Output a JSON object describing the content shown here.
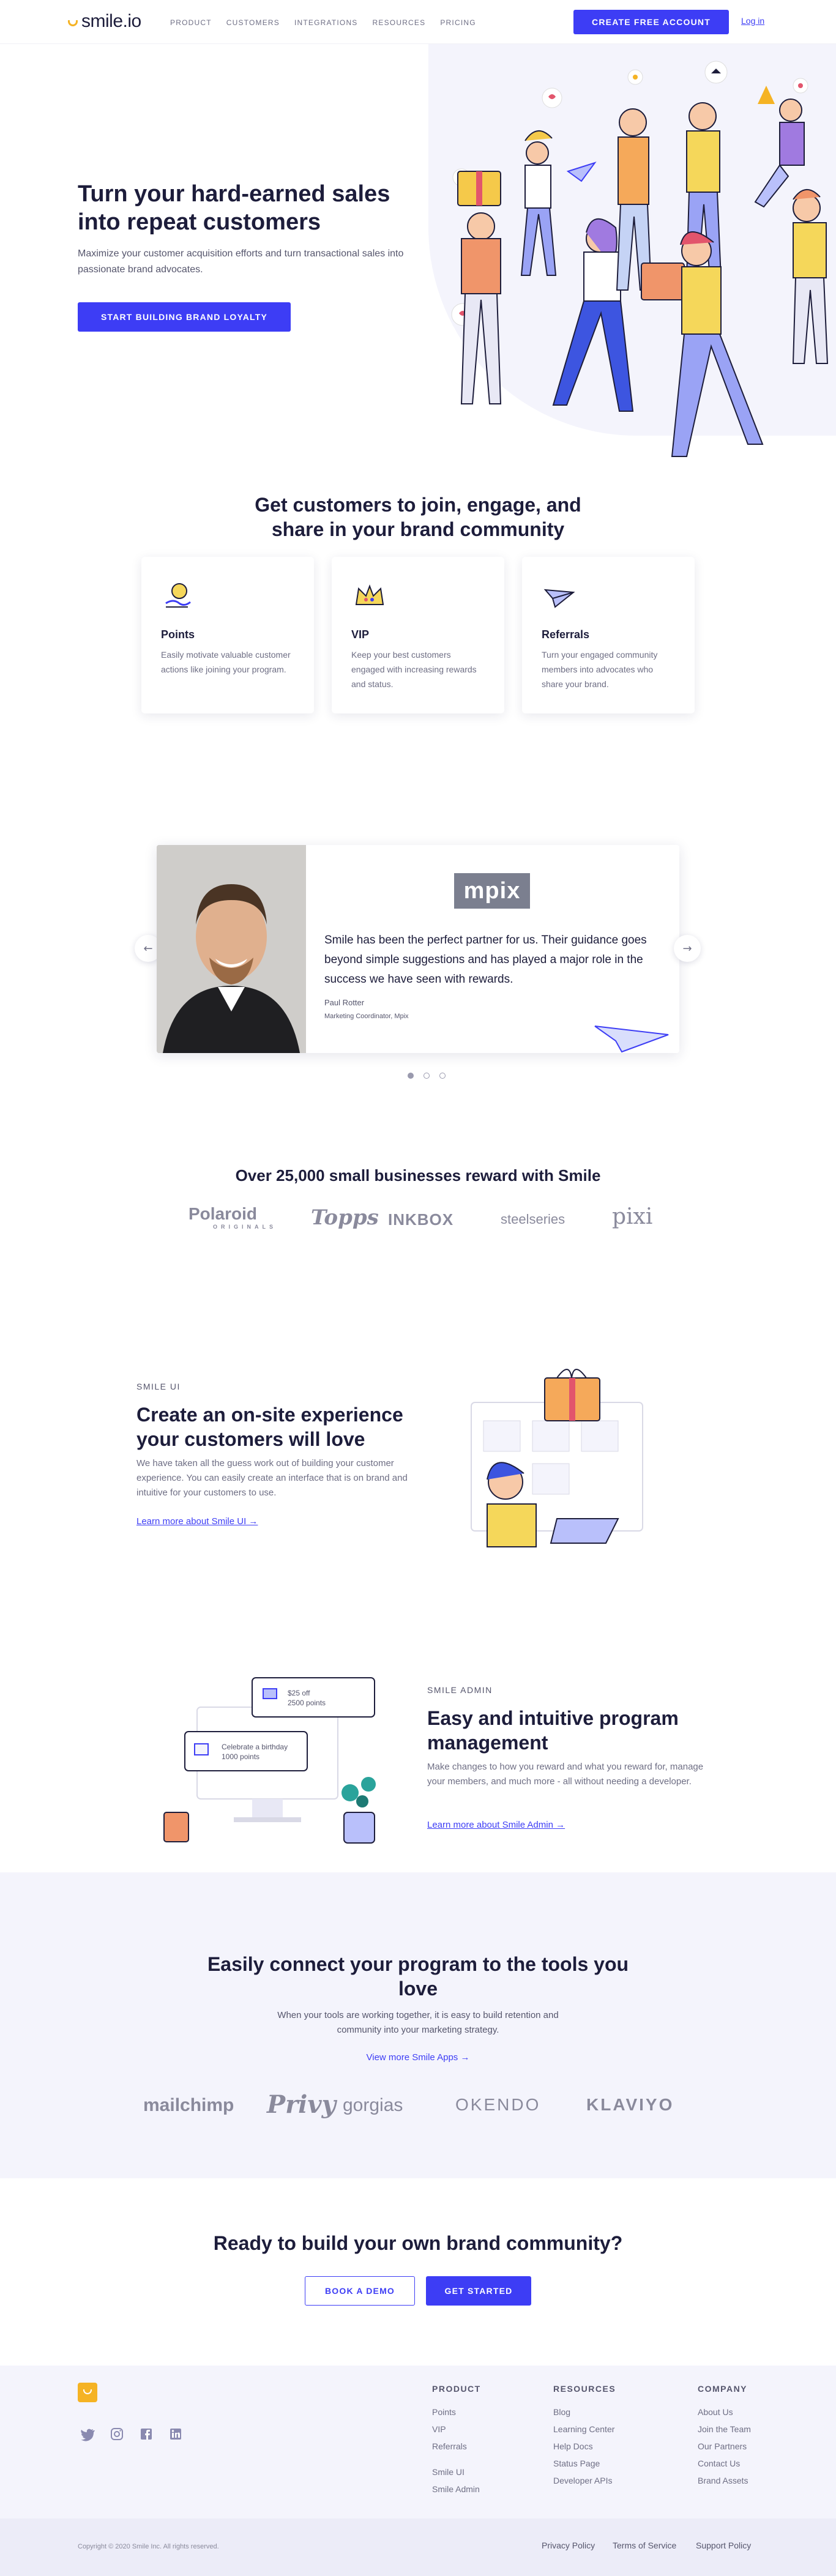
{
  "brand": {
    "name": "smile.io"
  },
  "nav": {
    "links": [
      "PRODUCT",
      "CUSTOMERS",
      "INTEGRATIONS",
      "RESOURCES",
      "PRICING"
    ],
    "cta_label": "CREATE FREE ACCOUNT",
    "login_label": "Log in"
  },
  "hero": {
    "title": "Turn your hard-earned sales into repeat customers",
    "subtitle": "Maximize your customer acquisition efforts and turn transactional sales into passionate brand advocates.",
    "cta_label": "START BUILDING BRAND LOYALTY"
  },
  "features": {
    "title": "Get customers to join, engage, and share in your brand community",
    "cards": [
      {
        "icon": "points-hand-icon",
        "title": "Points",
        "desc": "Easily motivate valuable customer actions like joining your program."
      },
      {
        "icon": "crown-icon",
        "title": "VIP",
        "desc": "Keep your best customers engaged with increasing rewards and status."
      },
      {
        "icon": "paper-plane-icon",
        "title": "Referrals",
        "desc": "Turn your engaged community members into advocates who share your brand."
      }
    ]
  },
  "testimonial": {
    "logo": "mpix",
    "quote": "Smile has been the perfect partner for us. Their guidance goes beyond simple suggestions and has played a major role in the success we have seen with rewards.",
    "name": "Paul Rotter",
    "role": "Marketing Coordinator, Mpix",
    "prev_icon": "arrow-left-icon",
    "next_icon": "arrow-right-icon",
    "slides": 3,
    "active_slide": 1
  },
  "brands": {
    "title": "Over 25,000 small businesses reward with Smile",
    "logos": [
      "Polaroid",
      "ORIGINALS",
      "Topps",
      "INKBOX",
      "steelseries",
      "pixi"
    ]
  },
  "smile_ui": {
    "eyebrow": "SMILE UI",
    "title": "Create an on-site experience your customers will love",
    "desc": "We have taken all the guess work out of building your customer experience. You can easily create an interface that is on brand and intuitive for your customers to use.",
    "link": "Learn more about Smile UI →"
  },
  "smile_admin": {
    "eyebrow": "SMILE ADMIN",
    "title": "Easy and intuitive program management",
    "desc": "Make changes to how you reward and what you reward for, manage your members, and much more - all without needing a developer.",
    "link": "Learn more about Smile Admin →",
    "card1_title": "$25 off",
    "card1_sub": "2500 points",
    "card2_title": "Celebrate a birthday",
    "card2_sub": "1000 points"
  },
  "integrations": {
    "title": "Easily connect your program to the tools you love",
    "desc": "When your tools are working together, it is easy to build retention and community into your marketing strategy.",
    "link": "View more Smile Apps →",
    "logos": [
      "mailchimp",
      "Privy",
      "gorgias",
      "OKENDO",
      "KLAVIYO"
    ]
  },
  "cta": {
    "title": "Ready to build your own brand community?",
    "demo_label": "BOOK A DEMO",
    "start_label": "GET STARTED"
  },
  "footer": {
    "social": [
      "twitter-icon",
      "instagram-icon",
      "facebook-icon",
      "linkedin-icon"
    ],
    "product": {
      "title": "PRODUCT",
      "items": [
        "Points",
        "VIP",
        "Referrals",
        "Smile UI",
        "Smile Admin"
      ]
    },
    "resources": {
      "title": "RESOURCES",
      "items": [
        "Blog",
        "Learning Center",
        "Help Docs",
        "Status Page",
        "Developer APIs"
      ]
    },
    "company": {
      "title": "COMPANY",
      "items": [
        "About Us",
        "Join the Team",
        "Our Partners",
        "Contact Us",
        "Brand Assets"
      ]
    },
    "copyright": "Copyright © 2020 Smile Inc. All rights reserved.",
    "legal": [
      "Privacy Policy",
      "Terms of Service",
      "Support Policy"
    ]
  },
  "colors": {
    "accent": "#3d3df5",
    "brand_yellow": "#f5b324",
    "bg_light": "#f4f4fc",
    "text_dark": "#1d1d3b"
  }
}
